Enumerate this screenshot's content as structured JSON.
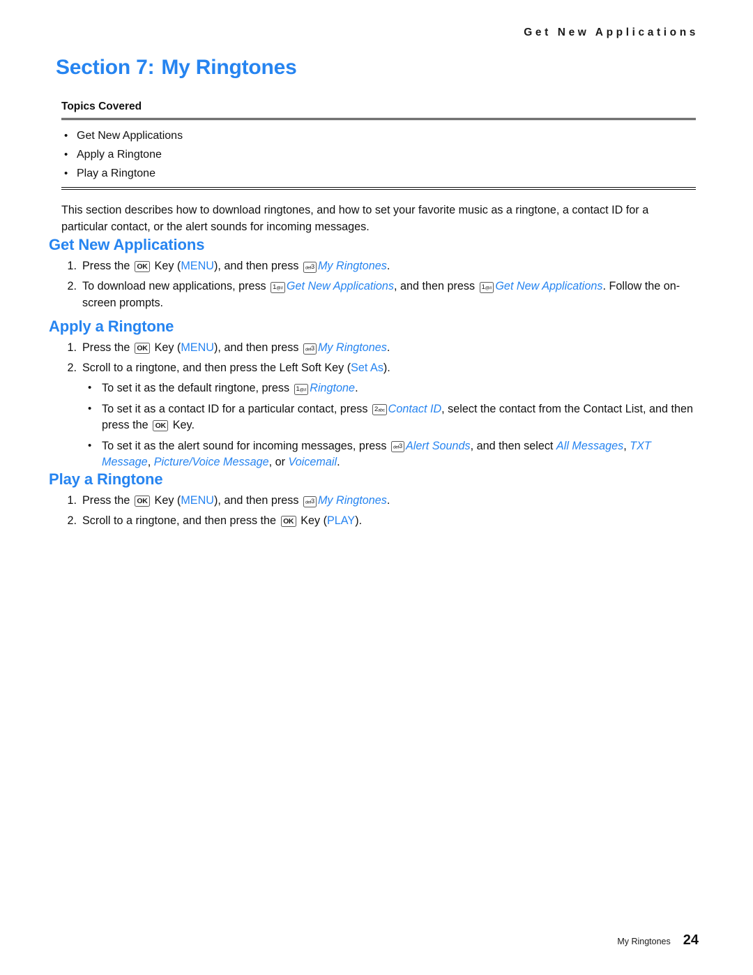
{
  "running_header": "Get New Applications",
  "section_title": {
    "prefix": "Section 7:",
    "name": "My Ringtones"
  },
  "topics": {
    "label": "Topics Covered",
    "items": [
      "Get New Applications",
      "Apply a Ringtone",
      "Play a Ringtone"
    ]
  },
  "intro": "This section describes how to download ringtones, and how to set your favorite music as a ringtone, a contact ID for a particular contact, or the alert sounds for incoming messages.",
  "keys": {
    "ok": "OK",
    "one_at_digit": "1",
    "one_at_sub": "@#",
    "two_abc_digit": "2",
    "two_abc_sub": "abc",
    "def_three_sub": "def",
    "def_three_digit": "3"
  },
  "sections": {
    "get_new_applications": {
      "heading": "Get New Applications",
      "step1": {
        "num": "1.",
        "t1": "Press the ",
        "t2": " Key (",
        "menu": "MENU",
        "t3": "), and then press ",
        "target": "My Ringtones",
        "t4": "."
      },
      "step2": {
        "num": "2.",
        "t1": "To download new applications, press ",
        "target1": "Get New Applications",
        "t2": ", and then press ",
        "target2": "Get New Applications",
        "t3": ". Follow the on-screen prompts."
      }
    },
    "apply_a_ringtone": {
      "heading": "Apply a Ringtone",
      "step1": {
        "num": "1.",
        "t1": "Press the ",
        "t2": " Key (",
        "menu": "MENU",
        "t3": "), and then press ",
        "target": "My Ringtones",
        "t4": "."
      },
      "step2": {
        "num": "2.",
        "t1": "Scroll to a ringtone, and then press the Left Soft Key (",
        "softkey": "Set As",
        "t2": ")."
      },
      "sub1": {
        "t1": "To set it as the default ringtone, press ",
        "target": "Ringtone",
        "t2": "."
      },
      "sub2": {
        "t1": "To set it as a contact ID for a particular contact, press ",
        "target": "Contact ID",
        "t2": ", select the contact from the Contact List, and then press the ",
        "t3": " Key."
      },
      "sub3": {
        "t1": "To set it as the alert sound for incoming messages, press ",
        "target": "Alert Sounds",
        "t2": ", and then select ",
        "opt1": "All Messages",
        "sep1": ", ",
        "opt2": "TXT Message",
        "sep2": ", ",
        "opt3": "Picture/Voice Message",
        "sep3": ", or ",
        "opt4": "Voicemail",
        "t3": "."
      }
    },
    "play_a_ringtone": {
      "heading": "Play a Ringtone",
      "step1": {
        "num": "1.",
        "t1": "Press the ",
        "t2": " Key (",
        "menu": "MENU",
        "t3": "), and then press ",
        "target": "My Ringtones",
        "t4": "."
      },
      "step2": {
        "num": "2.",
        "t1": "Scroll to a ringtone, and then press the ",
        "t2": " Key (",
        "play": "PLAY",
        "t3": ")."
      }
    }
  },
  "footer": {
    "label": "My Ringtones",
    "page": "24"
  },
  "colors": {
    "accent_blue": "#2684f0",
    "text_black": "#111111",
    "rule": "#111111"
  }
}
